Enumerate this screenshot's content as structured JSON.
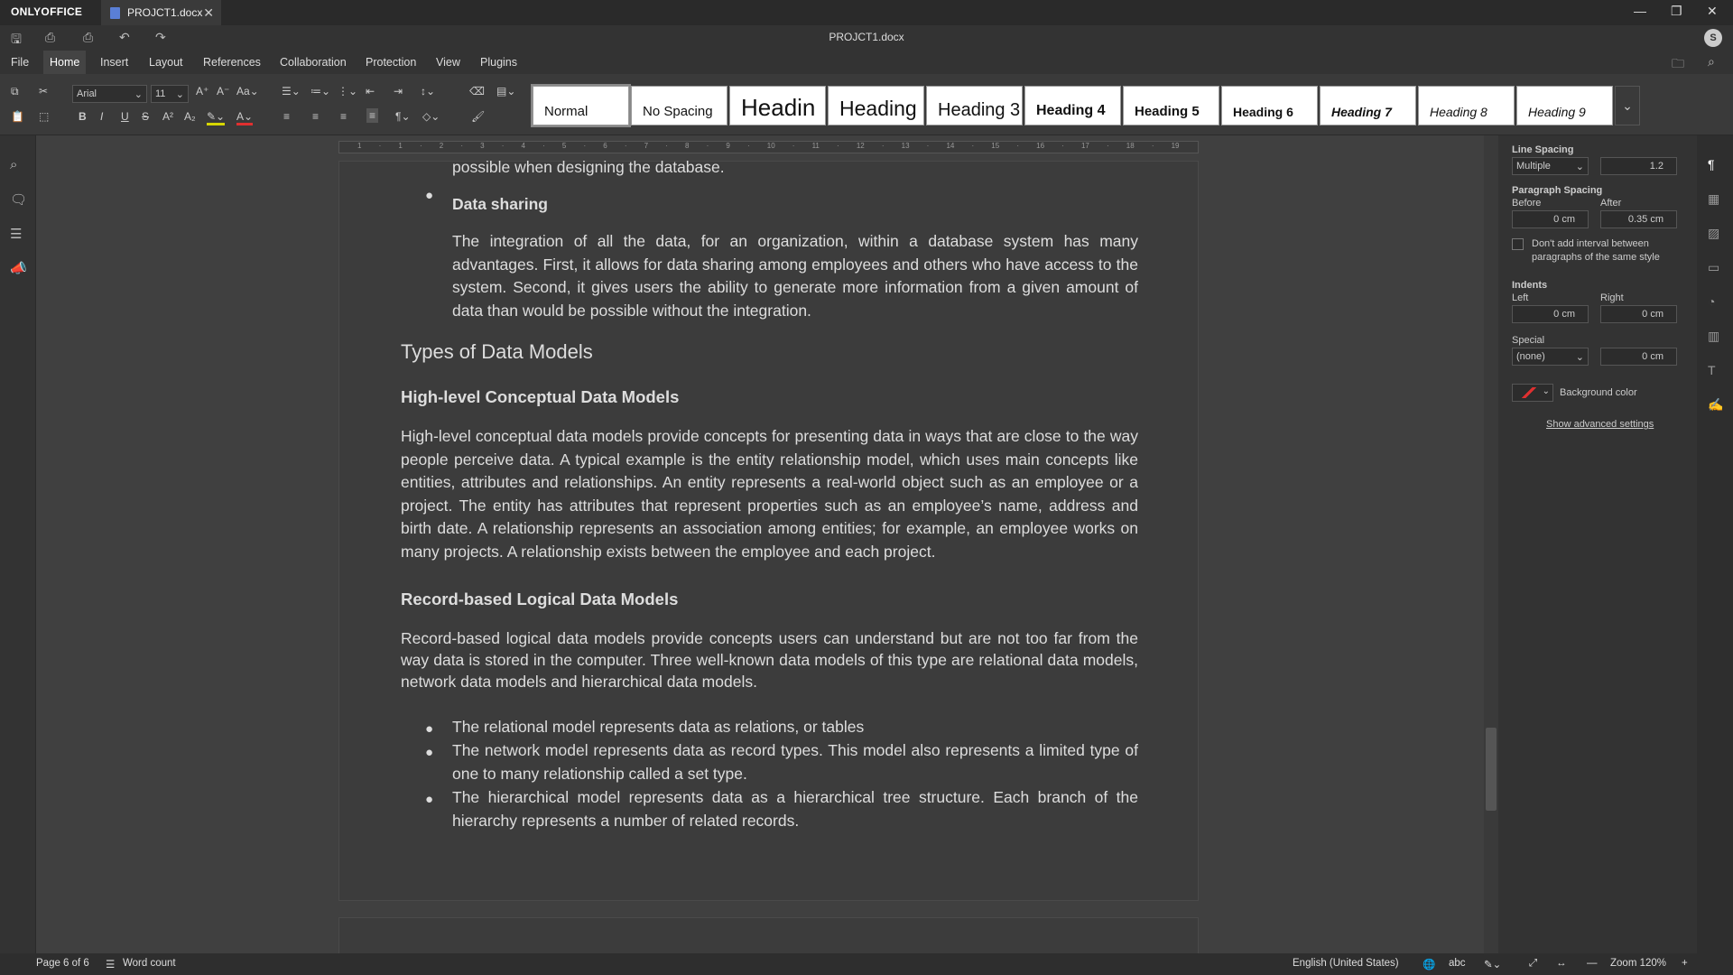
{
  "app": {
    "brand": "ONLYOFFICE",
    "tab_name": "PROJCT1.docx",
    "doc_title": "PROJCT1.docx",
    "avatar_initial": "S"
  },
  "menu": [
    "File",
    "Home",
    "Insert",
    "Layout",
    "References",
    "Collaboration",
    "Protection",
    "View",
    "Plugins"
  ],
  "ribbon": {
    "font_name": "Arial",
    "font_size": "11",
    "styles": [
      "Normal",
      "No Spacing",
      "Headin",
      "Heading",
      "Heading 3",
      "Heading 4",
      "Heading 5",
      "Heading 6",
      "Heading 7",
      "Heading 8",
      "Heading 9"
    ]
  },
  "ruler_ticks": [
    "1",
    "·",
    "1",
    "·",
    "2",
    "·",
    "3",
    "·",
    "4",
    "·",
    "5",
    "·",
    "6",
    "·",
    "7",
    "·",
    "8",
    "·",
    "9",
    "·",
    "10",
    "·",
    "11",
    "·",
    "12",
    "·",
    "13",
    "·",
    "14",
    "·",
    "15",
    "·",
    "16",
    "·",
    "17",
    "·",
    "18",
    "·",
    "19"
  ],
  "document": {
    "top_fragment": "possible when designing the database.",
    "bullet_heading": "Data sharing",
    "para1": "The integration of all the data, for an organization, within a database system has many advantages. First, it allows for data sharing among employees and others who have access to the system. Second, it gives users the ability to generate more information from a given amount of data than would be possible without the integration.",
    "h_types": "Types of Data Models",
    "h_highlevel": "High-level Conceptual Data Models",
    "para2": "High-level conceptual data models provide concepts for presenting data in ways that are close to the way people perceive data. A typical example is the entity relationship model, which uses main concepts like entities, attributes and relationships. An entity represents a real-world object such as an employee or a project. The entity has attributes that represent properties such as an employee’s name, address and birth date. A relationship represents an association among entities; for example, an employee works on many projects. A relationship exists between the employee and each project.",
    "h_record": "Record-based Logical Data Models",
    "para3": "Record-based logical data models provide concepts users can understand but are not too far from the way data is stored in the computer. Three well-known data models of this type are relational data models, network data models and hierarchical data models.",
    "bullets": [
      "The relational model represents data as relations, or tables",
      "The network model represents data as record types. This model also represents a limited type of one to many relationship called a set type.",
      "The hierarchical model represents data as a hierarchical tree structure. Each branch of the hierarchy represents a number of related records."
    ]
  },
  "panel": {
    "line_spacing_label": "Line Spacing",
    "line_spacing_mode": "Multiple",
    "line_spacing_value": "1.2",
    "para_spacing_label": "Paragraph Spacing",
    "before_label": "Before",
    "before_value": "0 cm",
    "after_label": "After",
    "after_value": "0.35 cm",
    "dont_add_label": "Don't add interval between paragraphs of the same style",
    "indents_label": "Indents",
    "left_label": "Left",
    "left_value": "0 cm",
    "right_label": "Right",
    "right_value": "0 cm",
    "special_label": "Special",
    "special_value": "(none)",
    "special_amount": "0 cm",
    "bg_color_label": "Background color",
    "advanced_link": "Show advanced settings"
  },
  "status": {
    "page": "Page 6 of 6",
    "word_count": "Word count",
    "language": "English (United States)",
    "zoom": "Zoom 120%"
  }
}
